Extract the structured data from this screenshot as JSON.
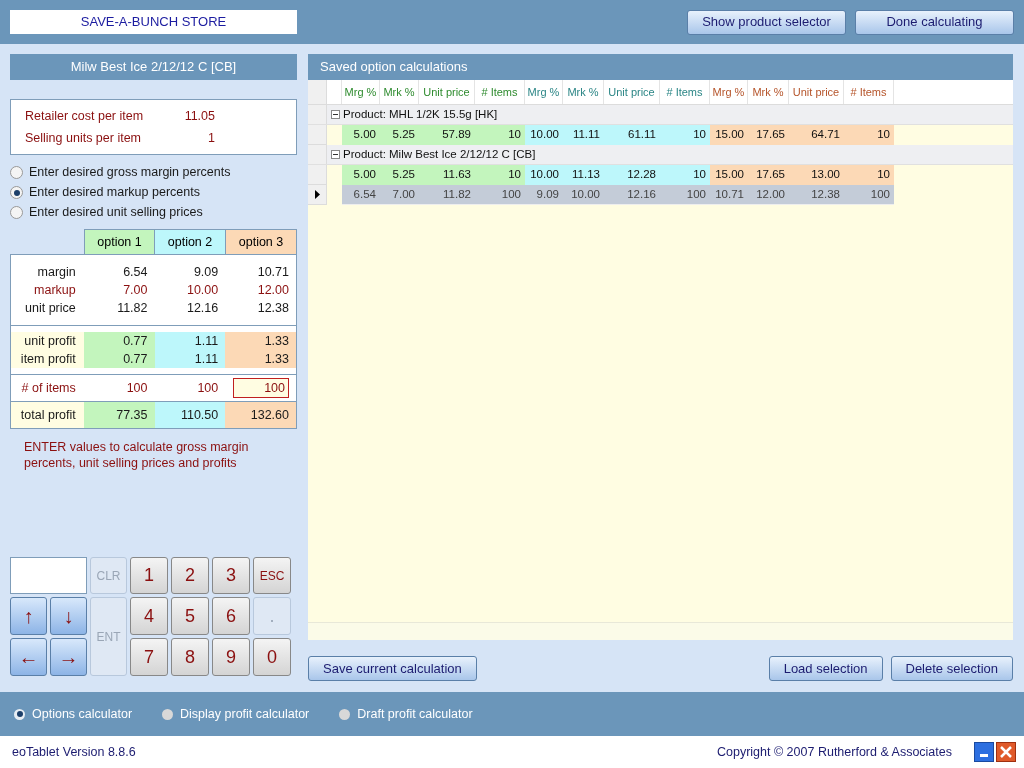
{
  "store_name": "SAVE-A-BUNCH STORE",
  "top_buttons": [
    "Show product selector",
    "Done calculating"
  ],
  "product_title": "Milw Best Ice 2/12/12 C [CB]",
  "cost_info": [
    {
      "label": "Retailer cost per item",
      "value": "11.05"
    },
    {
      "label": "Selling units per item",
      "value": "1"
    }
  ],
  "entry_modes": [
    {
      "label": "Enter desired gross margin percents",
      "selected": false
    },
    {
      "label": "Enter desired markup percents",
      "selected": true
    },
    {
      "label": "Enter desired unit selling prices",
      "selected": false
    }
  ],
  "options_table": {
    "columns": [
      "option 1",
      "option 2",
      "option 3"
    ],
    "rows": [
      {
        "kind": "calc",
        "label": "margin",
        "editable": false,
        "values": [
          "6.54",
          "9.09",
          "10.71"
        ]
      },
      {
        "kind": "calc",
        "label": "markup",
        "editable": true,
        "values": [
          "7.00",
          "10.00",
          "12.00"
        ]
      },
      {
        "kind": "calc",
        "label": "unit price",
        "editable": false,
        "values": [
          "11.82",
          "12.16",
          "12.38"
        ]
      },
      {
        "kind": "profit",
        "label": "unit profit",
        "editable": false,
        "values": [
          "0.77",
          "1.11",
          "1.33"
        ]
      },
      {
        "kind": "profit",
        "label": "item profit",
        "editable": false,
        "values": [
          "0.77",
          "1.11",
          "1.33"
        ]
      },
      {
        "kind": "items",
        "label": "# of items",
        "editable": true,
        "values": [
          "100",
          "100",
          "100"
        ],
        "focused": [
          false,
          false,
          true
        ]
      },
      {
        "kind": "total",
        "label": "total profit",
        "editable": false,
        "values": [
          "77.35",
          "110.50",
          "132.60"
        ]
      }
    ]
  },
  "hint": "ENTER values to calculate gross margin percents, unit selling prices and profits",
  "keypad": [
    {
      "kind": "display"
    },
    {
      "kind": "key",
      "label": "CLR",
      "enabled": false
    },
    {
      "kind": "key",
      "label": "1",
      "enabled": true
    },
    {
      "kind": "key",
      "label": "2",
      "enabled": true
    },
    {
      "kind": "key",
      "label": "3",
      "enabled": true
    },
    {
      "kind": "key",
      "label": "ESC",
      "enabled": true
    },
    {
      "kind": "arrow",
      "label": "↑"
    },
    {
      "kind": "arrow",
      "label": "↓"
    },
    {
      "kind": "tall",
      "label": "ENT",
      "enabled": false
    },
    {
      "kind": "key",
      "label": "4",
      "enabled": true
    },
    {
      "kind": "key",
      "label": "5",
      "enabled": true
    },
    {
      "kind": "key",
      "label": "6",
      "enabled": true
    },
    {
      "kind": "key",
      "label": ".",
      "enabled": false
    },
    {
      "kind": "arrow",
      "label": "←"
    },
    {
      "kind": "arrow",
      "label": "→"
    },
    {
      "kind": "key",
      "label": "7",
      "enabled": true
    },
    {
      "kind": "key",
      "label": "8",
      "enabled": true
    },
    {
      "kind": "key",
      "label": "9",
      "enabled": true
    },
    {
      "kind": "key",
      "label": "0",
      "enabled": true
    }
  ],
  "saved": {
    "title": "Saved option calculations",
    "columns": [
      "Mrg %",
      "Mrk %",
      "Unit price",
      "# Items",
      "Mrg %",
      "Mrk %",
      "Unit price",
      "# Items",
      "Mrg %",
      "Mrk %",
      "Unit price",
      "# Items"
    ],
    "products": [
      {
        "name": "Product: MHL 1/2K 15.5g [HK]",
        "expanded": true,
        "rows": [
          {
            "selected": false,
            "cells": [
              "5.00",
              "5.25",
              "57.89",
              "10",
              "10.00",
              "11.11",
              "61.11",
              "10",
              "15.00",
              "17.65",
              "64.71",
              "10"
            ]
          }
        ]
      },
      {
        "name": "Product: Milw Best Ice 2/12/12 C [CB]",
        "expanded": true,
        "rows": [
          {
            "selected": false,
            "cells": [
              "5.00",
              "5.25",
              "11.63",
              "10",
              "10.00",
              "11.13",
              "12.28",
              "10",
              "15.00",
              "17.65",
              "13.00",
              "10"
            ]
          },
          {
            "selected": true,
            "cells": [
              "6.54",
              "7.00",
              "11.82",
              "100",
              "9.09",
              "10.00",
              "12.16",
              "100",
              "10.71",
              "12.00",
              "12.38",
              "100"
            ]
          }
        ]
      }
    ]
  },
  "left_button": "Save current calculation",
  "right_buttons": [
    "Load selection",
    "Delete selection"
  ],
  "calculator_modes": [
    {
      "label": "Options calculator",
      "selected": true
    },
    {
      "label": "Display profit calculator",
      "selected": false
    },
    {
      "label": "Draft profit calculator",
      "selected": false
    }
  ],
  "version": "eoTablet Version 8.8.6",
  "copyright": "Copyright © 2007 Rutherford & Associates"
}
